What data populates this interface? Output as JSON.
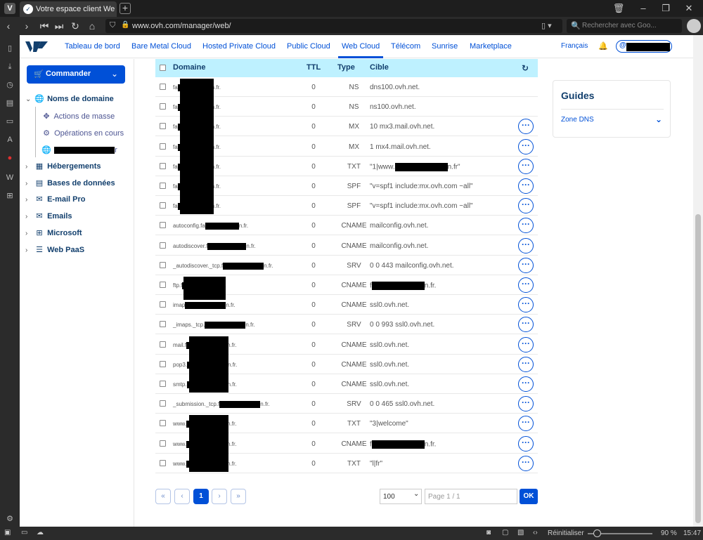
{
  "browser": {
    "tab_title": "Votre espace client Web OVH",
    "url": "www.ovh.com/manager/web/",
    "search_placeholder": "Rechercher avec Goo...",
    "status": {
      "reset_label": "Réinitialiser",
      "zoom": "90 %",
      "clock": "15:47"
    }
  },
  "nav": {
    "items": [
      "Tableau de bord",
      "Bare Metal Cloud",
      "Hosted Private Cloud",
      "Public Cloud",
      "Web Cloud",
      "Télécom",
      "Sunrise",
      "Marketplace"
    ],
    "active": "Web Cloud",
    "language": "Français",
    "user_at": "@"
  },
  "sidebar": {
    "order_label": "Commander",
    "domains_label": "Noms de domaine",
    "mass_actions": "Actions de masse",
    "ops_in_progress": "Opérations en cours",
    "domain_suffix": "r",
    "sections": [
      "Hébergements",
      "Bases de données",
      "E-mail Pro",
      "Emails",
      "Microsoft",
      "Web PaaS"
    ]
  },
  "table": {
    "headers": {
      "domain": "Domaine",
      "ttl": "TTL",
      "type": "Type",
      "target": "Cible"
    },
    "rows": [
      {
        "pre": "fa",
        "redact": 48,
        "post": "n.fr.",
        "ttl": "0",
        "type": "NS",
        "target_pre": "dns100.ovh.net.",
        "target_redact": 0,
        "target_post": "",
        "more": false
      },
      {
        "pre": "fa",
        "redact": 48,
        "post": "n.fr.",
        "ttl": "0",
        "type": "NS",
        "target_pre": "ns100.ovh.net.",
        "target_redact": 0,
        "target_post": "",
        "more": false
      },
      {
        "pre": "fa",
        "redact": 48,
        "post": "n.fr.",
        "ttl": "0",
        "type": "MX",
        "target_pre": "10 mx3.mail.ovh.net.",
        "target_redact": 0,
        "target_post": "",
        "more": true
      },
      {
        "pre": "fa",
        "redact": 48,
        "post": "n.fr.",
        "ttl": "0",
        "type": "MX",
        "target_pre": "1 mx4.mail.ovh.net.",
        "target_redact": 0,
        "target_post": "",
        "more": true
      },
      {
        "pre": "fa",
        "redact": 48,
        "post": "n.fr.",
        "ttl": "0",
        "type": "TXT",
        "target_pre": "\"1|www.",
        "target_redact": 75,
        "target_post": "n.fr\"",
        "more": true
      },
      {
        "pre": "fa",
        "redact": 48,
        "post": "n.fr.",
        "ttl": "0",
        "type": "SPF",
        "target_pre": "\"v=spf1 include:mx.ovh.com ~all\"",
        "target_redact": 0,
        "target_post": "",
        "more": true
      },
      {
        "pre": "fa",
        "redact": 48,
        "post": "n.fr.",
        "ttl": "0",
        "type": "SPF",
        "target_pre": "\"v=spf1 include:mx.ovh.com ~all\"",
        "target_redact": 0,
        "target_post": "",
        "more": true
      },
      {
        "pre": "autoconfig.fa",
        "redact": 48,
        "post": "n.fr.",
        "ttl": "0",
        "type": "CNAME",
        "target_pre": "mailconfig.ovh.net.",
        "target_redact": 0,
        "target_post": "",
        "more": true
      },
      {
        "pre": "autodiscover.f",
        "redact": 55,
        "post": "n.fr.",
        "ttl": "0",
        "type": "CNAME",
        "target_pre": "mailconfig.ovh.net.",
        "target_redact": 0,
        "target_post": "",
        "more": true
      },
      {
        "pre": "_autodiscover._tcp.f",
        "redact": 58,
        "post": "n.fr.",
        "ttl": "0",
        "type": "SRV",
        "target_pre": "0 0 443 mailconfig.ovh.net.",
        "target_redact": 0,
        "target_post": "",
        "more": true
      },
      {
        "pre": "ftp.f",
        "redact": 58,
        "post": "r.",
        "ttl": "0",
        "type": "CNAME",
        "target_pre": "f",
        "target_redact": 75,
        "target_post": "n.fr.",
        "more": true
      },
      {
        "pre": "imap",
        "redact": 58,
        "post": "n.fr.",
        "ttl": "0",
        "type": "CNAME",
        "target_pre": "ssl0.ovh.net.",
        "target_redact": 0,
        "target_post": "",
        "more": true
      },
      {
        "pre": "_imaps._tcp.",
        "redact": 58,
        "post": "n.fr.",
        "ttl": "0",
        "type": "SRV",
        "target_pre": "0 0 993 ssl0.ovh.net.",
        "target_redact": 0,
        "target_post": "",
        "more": true
      },
      {
        "pre": "mail.f",
        "redact": 58,
        "post": "n.fr.",
        "ttl": "0",
        "type": "CNAME",
        "target_pre": "ssl0.ovh.net.",
        "target_redact": 0,
        "target_post": "",
        "more": true
      },
      {
        "pre": "pop3.",
        "redact": 58,
        "post": "n.fr.",
        "ttl": "0",
        "type": "CNAME",
        "target_pre": "ssl0.ovh.net.",
        "target_redact": 0,
        "target_post": "",
        "more": true
      },
      {
        "pre": "smtp.",
        "redact": 58,
        "post": "n.fr.",
        "ttl": "0",
        "type": "CNAME",
        "target_pre": "ssl0.ovh.net.",
        "target_redact": 0,
        "target_post": "",
        "more": true
      },
      {
        "pre": "_submission._tcp.f",
        "redact": 58,
        "post": "n.fr.",
        "ttl": "0",
        "type": "SRV",
        "target_pre": "0 0 465 ssl0.ovh.net.",
        "target_redact": 0,
        "target_post": "",
        "more": true
      },
      {
        "pre": "www.",
        "redact": 58,
        "post": "n.fr.",
        "ttl": "0",
        "type": "TXT",
        "target_pre": "\"3|welcome\"",
        "target_redact": 0,
        "target_post": "",
        "more": true
      },
      {
        "pre": "www.",
        "redact": 58,
        "post": "n.fr.",
        "ttl": "0",
        "type": "CNAME",
        "target_pre": "f",
        "target_redact": 75,
        "target_post": "n.fr.",
        "more": true
      },
      {
        "pre": "www.",
        "redact": 58,
        "post": "n.fr.",
        "ttl": "0",
        "type": "TXT",
        "target_pre": "\"l|fr\"",
        "target_redact": 0,
        "target_post": "",
        "more": true
      }
    ]
  },
  "pagination": {
    "first": "«",
    "prev": "‹",
    "current": "1",
    "next": "›",
    "last": "»",
    "page_size": "100",
    "page_input_placeholder": "Page 1 / 1",
    "ok_label": "OK"
  },
  "guides": {
    "title": "Guides",
    "item": "Zone DNS"
  }
}
